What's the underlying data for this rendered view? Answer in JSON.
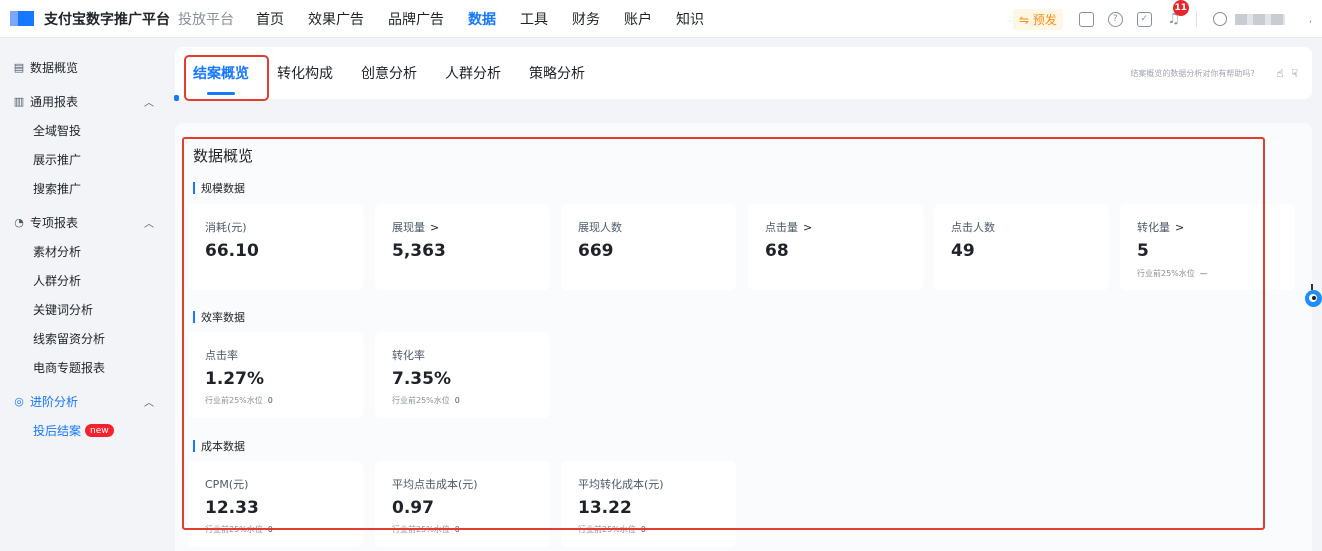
{
  "header": {
    "brand": "支付宝数字推广平台",
    "platform": "投放平台",
    "nav": [
      "首页",
      "效果广告",
      "品牌广告",
      "数据",
      "工具",
      "财务",
      "账户",
      "知识"
    ],
    "nav_active_index": 3,
    "preview_label": "⇋ 预发",
    "notification_count": "11"
  },
  "sidebar": {
    "overview": "数据概览",
    "groups": [
      {
        "title": "通用报表",
        "items": [
          "全域智投",
          "展示推广",
          "搜索推广"
        ]
      },
      {
        "title": "专项报表",
        "items": [
          "素材分析",
          "人群分析",
          "关键词分析",
          "线索留资分析",
          "电商专题报表"
        ]
      },
      {
        "title": "进阶分析",
        "items": [
          "投后结案"
        ]
      }
    ],
    "new_badge": "new"
  },
  "tabs": {
    "items": [
      "结案概览",
      "转化构成",
      "创意分析",
      "人群分析",
      "策略分析"
    ],
    "active_index": 0,
    "feedback_question": "结案概览的数据分析对你有帮助吗?"
  },
  "overview": {
    "title": "数据概览",
    "sections": [
      {
        "title": "规模数据",
        "metrics": [
          {
            "label": "消耗(元)",
            "value": "66.10"
          },
          {
            "label": "展现量",
            "value": "5,363",
            "link": true
          },
          {
            "label": "展现人数",
            "value": "669"
          },
          {
            "label": "点击量",
            "value": "68",
            "link": true
          },
          {
            "label": "点击人数",
            "value": "49"
          },
          {
            "label": "转化量",
            "value": "5",
            "link": true,
            "sub_label": "行业前25%水位",
            "sub_value": "—"
          }
        ]
      },
      {
        "title": "效率数据",
        "metrics": [
          {
            "label": "点击率",
            "value": "1.27%",
            "sub_label": "行业前25%水位",
            "sub_value": "0"
          },
          {
            "label": "转化率",
            "value": "7.35%",
            "sub_label": "行业前25%水位",
            "sub_value": "0"
          }
        ]
      },
      {
        "title": "成本数据",
        "metrics": [
          {
            "label": "CPM(元)",
            "value": "12.33",
            "sub_label": "行业前25%水位",
            "sub_value": "0"
          },
          {
            "label": "平均点击成本(元)",
            "value": "0.97",
            "sub_label": "行业前25%水位",
            "sub_value": "0"
          },
          {
            "label": "平均转化成本(元)",
            "value": "13.22",
            "sub_label": "行业前25%水位",
            "sub_value": "0"
          }
        ]
      }
    ]
  },
  "colors": {
    "accent": "#1677ff",
    "highlight": "#e23d2f",
    "badge": "#e5282c"
  },
  "icons": [
    "logo-icon",
    "tablet-icon",
    "help-icon",
    "task-icon",
    "bell-icon",
    "user-icon",
    "chart-icon",
    "bar-chart-icon",
    "clock-icon",
    "magnify-icon",
    "thumb-up-icon",
    "thumb-down-icon"
  ]
}
